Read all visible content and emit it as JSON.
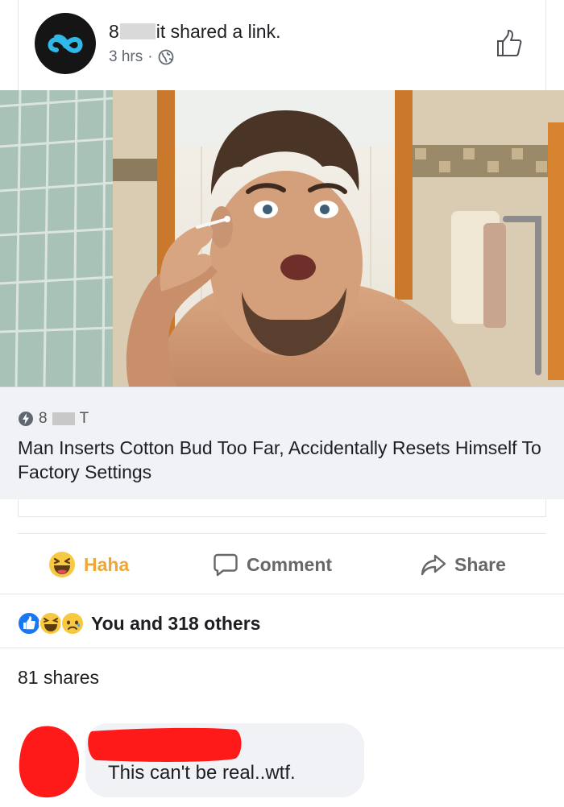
{
  "post": {
    "author_prefix": "8",
    "author_suffix": "it",
    "action_text": " shared a link.",
    "time": "3 hrs",
    "separator": "·"
  },
  "link": {
    "source_prefix": "8",
    "source_suffix": "T",
    "headline": "Man Inserts Cotton Bud Too Far, Accidentally Resets Himself To Factory Settings"
  },
  "actions": {
    "haha_label": "Haha",
    "comment_label": "Comment",
    "share_label": "Share"
  },
  "engagement": {
    "reactions_text": "You and 318 others",
    "shares_text": "81 shares"
  },
  "comment": {
    "text": "This can't be real..wtf."
  },
  "colors": {
    "haha": "#f0a632",
    "like_blue": "#1877f2",
    "redaction_red": "#ff1a1a",
    "avatar_bg": "#151515",
    "logo_blue": "#2fb9e8"
  },
  "icons": [
    "brand-logo-icon",
    "globe-icon",
    "thumbs-up-outline-icon",
    "bolt-icon",
    "haha-emoji-icon",
    "comment-bubble-icon",
    "share-arrow-icon",
    "like-reaction-icon",
    "sad-reaction-icon"
  ]
}
